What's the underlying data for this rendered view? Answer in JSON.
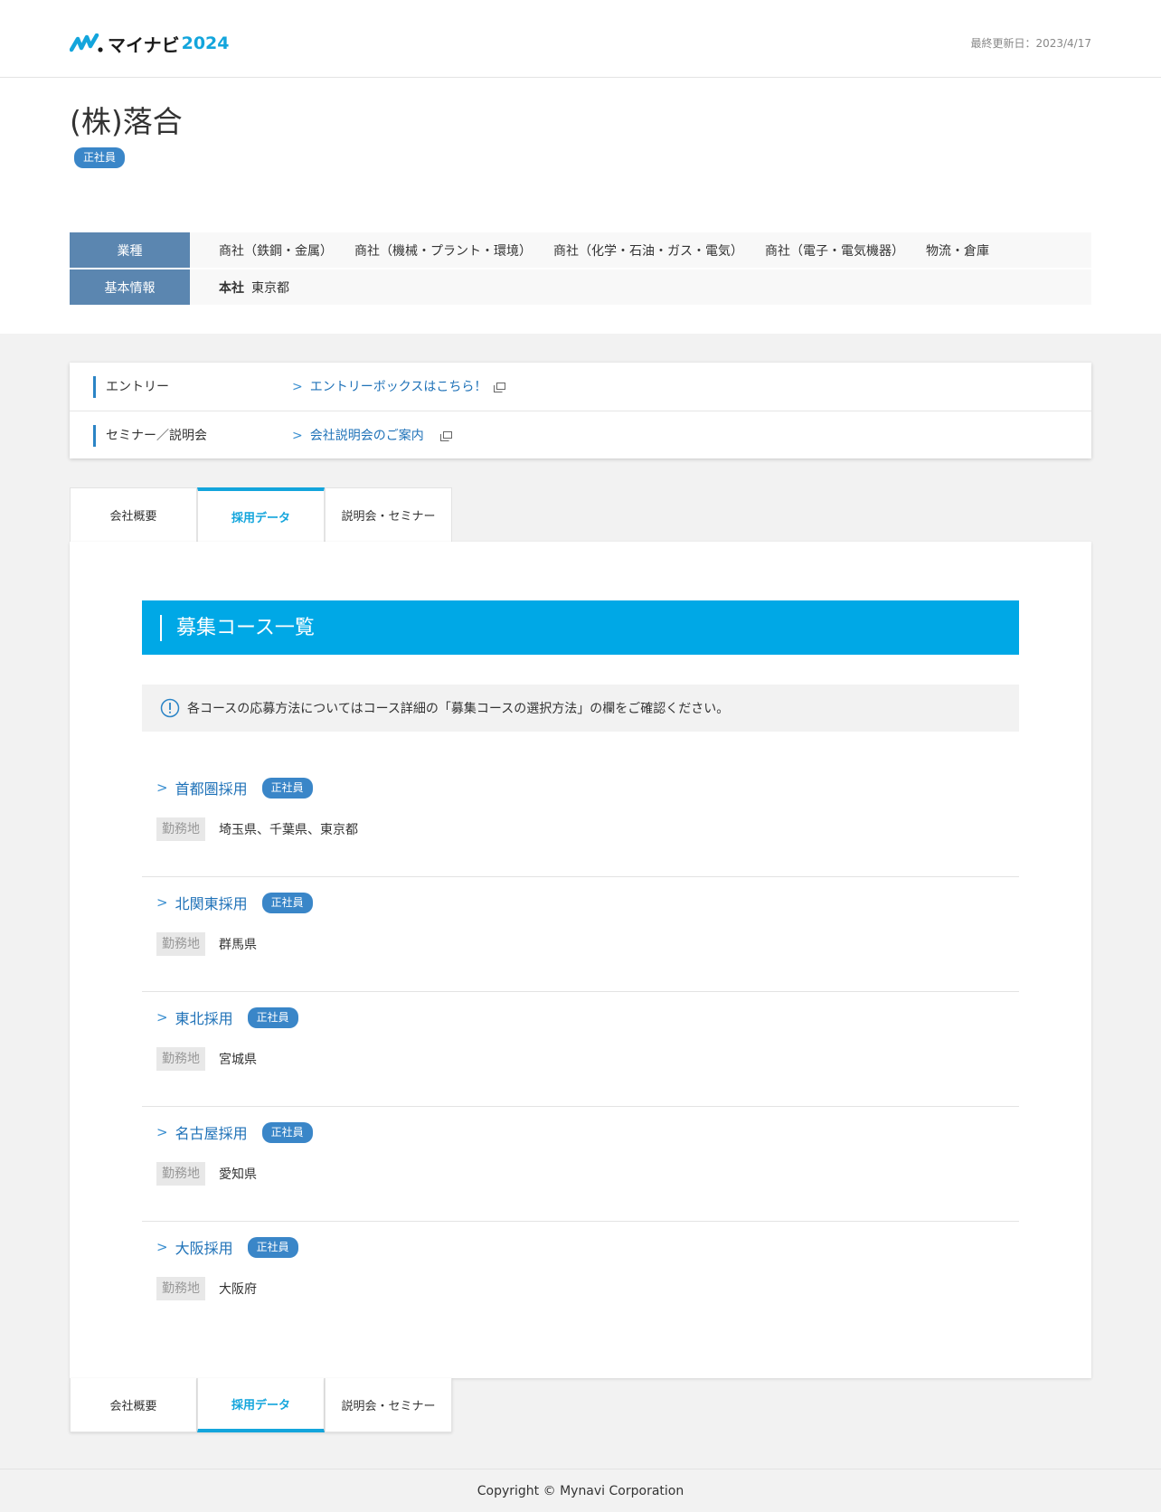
{
  "header": {
    "logo_text": "マイナビ",
    "logo_year": "2024",
    "updated": "最終更新日：2023/4/17"
  },
  "company": {
    "name": "(株)落合",
    "badge": "正社員"
  },
  "info": {
    "industry_label": "業種",
    "industries": [
      "商社（鉄鋼・金属）",
      "商社（機械・プラント・環境）",
      "商社（化学・石油・ガス・電気）",
      "商社（電子・電気機器）",
      "物流・倉庫"
    ],
    "basic_label": "基本情報",
    "hq_label": "本社",
    "hq_value": "東京都"
  },
  "entry": {
    "entry_label": "エントリー",
    "entry_link": "エントリーボックスはこちら！",
    "seminar_label": "セミナー／説明会",
    "seminar_link": "会社説明会のご案内"
  },
  "tabs": [
    "会社概要",
    "採用データ",
    "説明会・セミナー"
  ],
  "active_tab": "採用データ",
  "section": {
    "title": "募集コース一覧",
    "notice": "各コースの応募方法についてはコース詳細の「募集コースの選択方法」の欄をご確認ください。"
  },
  "location_label": "勤務地",
  "courses": [
    {
      "name": "首都圏採用",
      "badge": "正社員",
      "location": "埼玉県、千葉県、東京都"
    },
    {
      "name": "北関東採用",
      "badge": "正社員",
      "location": "群馬県"
    },
    {
      "name": "東北採用",
      "badge": "正社員",
      "location": "宮城県"
    },
    {
      "name": "名古屋採用",
      "badge": "正社員",
      "location": "愛知県"
    },
    {
      "name": "大阪採用",
      "badge": "正社員",
      "location": "大阪府"
    }
  ],
  "footer": {
    "copyright": "Copyright © Mynavi Corporation"
  },
  "colors": {
    "accent": "#13a5dc",
    "link": "#1f72b8",
    "badge": "#3a86c8",
    "table_head": "#5b86b0"
  }
}
